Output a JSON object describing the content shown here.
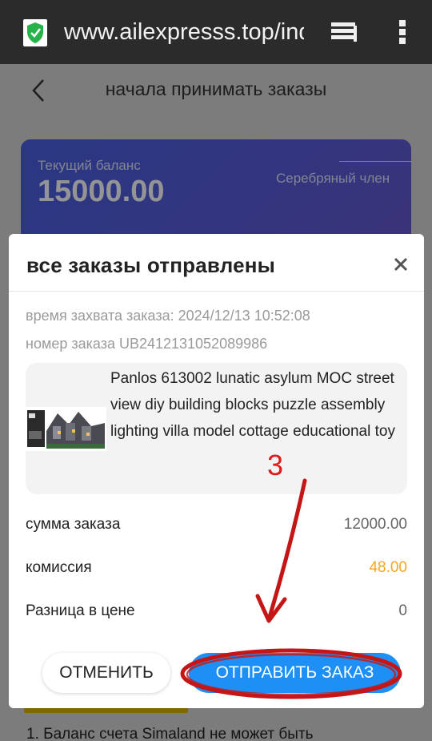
{
  "browser": {
    "url": "www.ailexpresss.top/inde",
    "icons": [
      "shield-icon",
      "tabs-icon",
      "menu-icon"
    ]
  },
  "page": {
    "title": "начала принимать заказы",
    "balance_label": "Текущий баланс",
    "balance_value": "15000.00",
    "member_label": "Серебряный член",
    "footer_note": "1. Баланс счета Simaland не может быть"
  },
  "modal": {
    "title": "все заказы отправлены",
    "grab_time": "время захвата заказа:  2024/12/13 10:52:08",
    "order_number": "номер заказа UB2412131052089986",
    "product": {
      "name": "Panlos 613002 lunatic asylum MOC street view diy building blocks puzzle assembly lighting villa model cottage educational toy"
    },
    "rows": [
      {
        "label": "сумма заказа",
        "value": "12000.00"
      },
      {
        "label": "комиссия",
        "value": "48.00"
      },
      {
        "label": "Разница в цене",
        "value": "0"
      }
    ],
    "cancel_label": "ОТМЕНИТЬ",
    "submit_label": "ОТПРАВИТЬ ЗАКАЗ"
  },
  "annotation": {
    "step_number": "3",
    "color": "#d01818"
  },
  "colors": {
    "submit": "#1e90f5",
    "commission": "#f5a623",
    "card": "#4960e3"
  }
}
